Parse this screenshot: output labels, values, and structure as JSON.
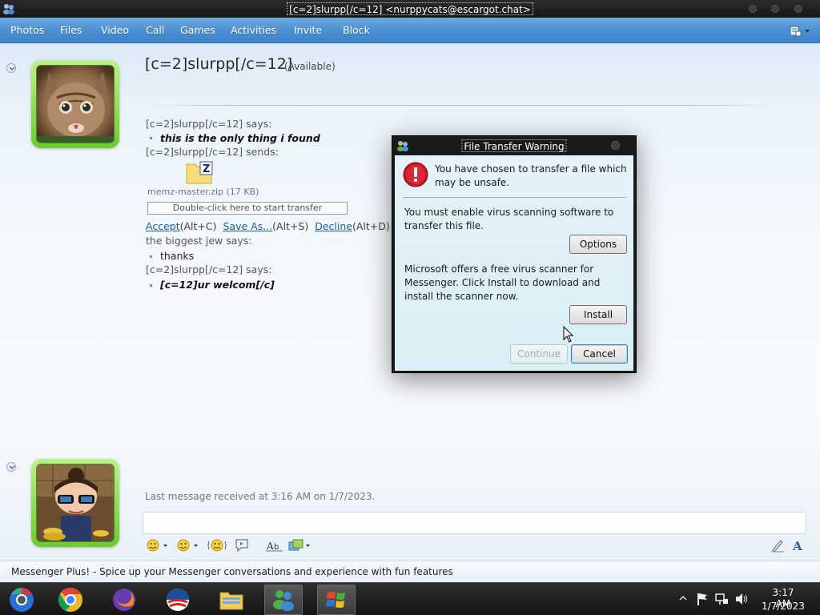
{
  "window": {
    "title": "[c=2]slurpp[/c=12] <nurppycats@escargot.chat>"
  },
  "menu": {
    "items": [
      "Photos",
      "Files",
      "Video",
      "Call",
      "Games",
      "Activities",
      "Invite",
      "Block"
    ]
  },
  "contact": {
    "name": "[c=2]slurpp[/c=12]",
    "status": "(Available)"
  },
  "conversation": {
    "line1_sender": "[c=2]slurpp[/c=12] says:",
    "line1_msg": "this is the only thing i found",
    "line2_sender": "[c=2]slurpp[/c=12] sends:",
    "file_name": "memz-master.zip (17 KB)",
    "transfer_hint": "Double-click here to start transfer",
    "accept": "Accept",
    "accept_key": "(Alt+C)",
    "save_as": "Save As...",
    "save_as_key": "(Alt+S)",
    "decline": "Decline",
    "decline_key": "(Alt+D)",
    "line3_sender": "the biggest jew says:",
    "line3_msg": "thanks",
    "line4_sender": "[c=2]slurpp[/c=12] says:",
    "line4_msg": "[c=12]ur welcom[/c]"
  },
  "footer": {
    "last_message": "Last message received at 3:16 AM on 1/7/2023.",
    "plus_text": "Messenger Plus! - Spice up your Messenger conversations and experience with fun features"
  },
  "dialog": {
    "title": "File Transfer Warning",
    "warning_text": "You have chosen to transfer a file which may be unsafe.",
    "virus_text": "You must enable virus scanning software to transfer this file.",
    "options_label": "Options",
    "scanner_text": "Microsoft offers a free virus scanner for Messenger. Click Install to download and install the scanner now.",
    "install_label": "Install",
    "continue_label": "Continue",
    "cancel_label": "Cancel"
  },
  "taskbar": {
    "apps": [
      "chrome-dev-icon",
      "chrome-icon",
      "firefox-icon",
      "obama-icon",
      "file-explorer-icon",
      "messenger-icon",
      "windows-xp-icon"
    ],
    "time": "3:17 AM",
    "date": "1/7/2023"
  },
  "colors": {
    "menubar": "#4a8fd2",
    "avatar_frame": "#6acb2f",
    "link": "#1a5ea8"
  }
}
